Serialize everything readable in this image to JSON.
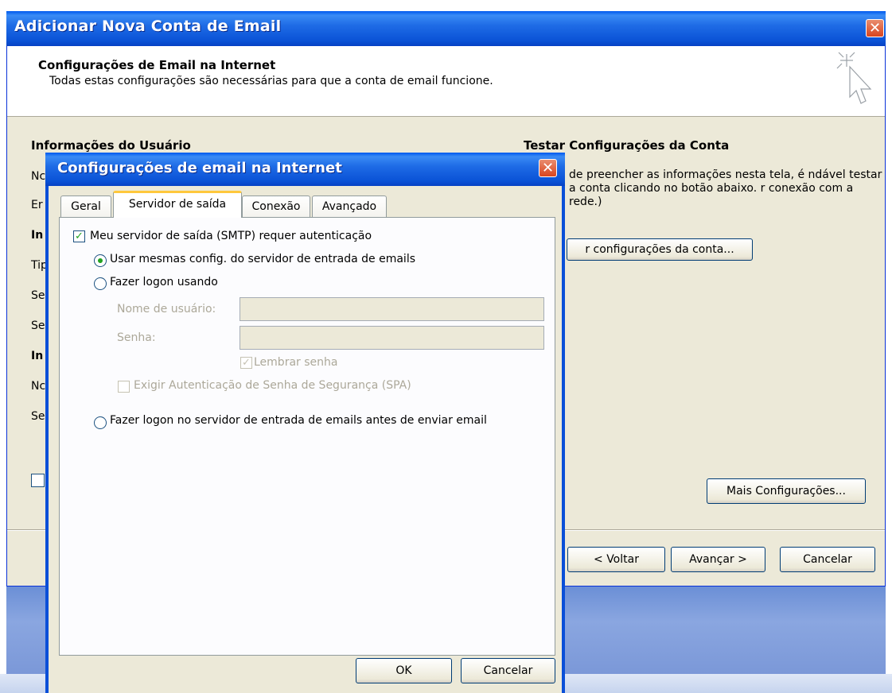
{
  "main_window": {
    "title": "Adicionar Nova Conta de Email",
    "header_title": "Configurações de Email na Internet",
    "header_subtitle": "Todas estas configurações são necessárias para que a conta de email funcione.",
    "section_user": "Informações do Usuário",
    "section_test": "Testar Configurações da Conta",
    "test_description": "de preencher as informações nesta tela, é ndável testar a conta clicando no botão abaixo. r conexão com a rede.)",
    "test_button": "r configurações da conta...",
    "more_settings_button": "Mais Configurações...",
    "back_button": "< Voltar",
    "next_button": "Avançar >",
    "cancel_button": "Cancelar",
    "left_labels_cut": [
      "Nc",
      "Er",
      "In",
      "Tip",
      "Se",
      "Se",
      "In",
      "Nc",
      "Se"
    ]
  },
  "dialog": {
    "title": "Configurações de email na Internet",
    "tabs": [
      "Geral",
      "Servidor de saída",
      "Conexão",
      "Avançado"
    ],
    "active_tab": 1,
    "smtp_auth_checkbox": "Meu servidor de saída (SMTP) requer autenticação",
    "smtp_auth_checked": true,
    "radio_same_settings": "Usar mesmas config. do servidor de entrada de emails",
    "radio_logon_using": "Fazer logon usando",
    "username_label": "Nome de usuário:",
    "username_value": "",
    "password_label": "Senha:",
    "password_value": "",
    "remember_password": "Lembrar senha",
    "require_spa": "Exigir Autenticação de Senha de Segurança (SPA)",
    "radio_logon_before": "Fazer logon no servidor de entrada de emails antes de enviar email",
    "selected_radio": "same_settings",
    "ok_button": "OK",
    "cancel_button": "Cancelar"
  },
  "colors": {
    "titlebar": "#0a52d6",
    "window_bg": "#ece9d8",
    "check_green": "#21a121",
    "tab_highlight": "#ffc83c"
  },
  "icons": {
    "close": "close-icon",
    "wizard": "cursor-sparkle-icon",
    "check": "checkmark-icon"
  }
}
